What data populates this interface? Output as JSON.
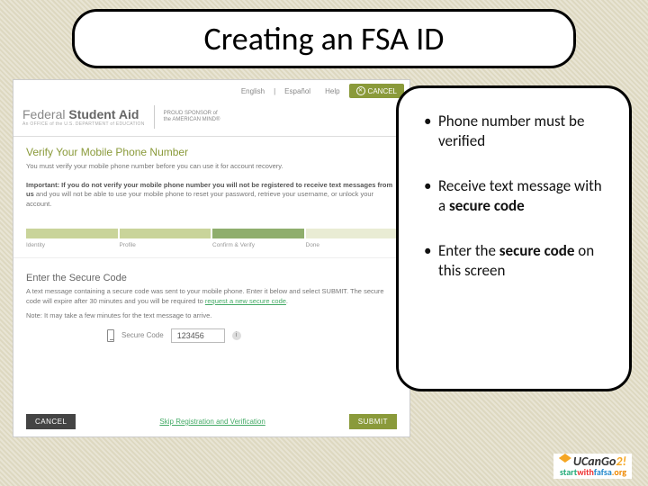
{
  "title": "Creating an FSA ID",
  "bullets": [
    {
      "pre": "Phone number must be verified",
      "bold": "",
      "post": ""
    },
    {
      "pre": "Receive text message with a ",
      "bold": "secure code",
      "post": ""
    },
    {
      "pre": "Enter the ",
      "bold": "secure code",
      "post": " on this screen"
    }
  ],
  "screenshot": {
    "topbar": {
      "lang1": "English",
      "lang2": "Español",
      "help": "Help",
      "cancel": "CANCEL"
    },
    "logo": {
      "thin": "Federal ",
      "bold": "Student Aid",
      "sub": "An OFFICE of the U.S. DEPARTMENT of EDUCATION",
      "sponsor_line1": "PROUD SPONSOR of",
      "sponsor_line2": "the AMERICAN MIND®"
    },
    "verify": {
      "heading": "Verify Your Mobile Phone Number",
      "text1": "You must verify your mobile phone number before you can use it for account recovery.",
      "text2_a": "Important: If you do not verify your mobile phone number you will not be registered to receive text messages from us",
      "text2_b": " and you will not be able to use your mobile phone to reset your password, retrieve your username, or unlock your account."
    },
    "progress": {
      "steps": [
        "Identity",
        "Profile",
        "Confirm & Verify",
        "Done"
      ]
    },
    "secure": {
      "heading": "Enter the Secure Code",
      "text1_a": "A text message containing a secure code was sent to your mobile phone. Enter it below and select SUBMIT. The secure code will expire after 30 minutes and you will be required to ",
      "text1_link": "request a new secure code",
      "text1_b": ".",
      "note": "Note: It may take a few minutes for the text message to arrive.",
      "label": "Secure Code",
      "value": "123456"
    },
    "footer": {
      "cancel": "CANCEL",
      "skip": "Skip Registration and Verification",
      "submit": "SUBMIT"
    }
  },
  "footer_logos": {
    "ucan_a": "UCan",
    "ucan_b": "Go",
    "ucan_c": "2!",
    "swf": "startwithfafsa.org"
  }
}
